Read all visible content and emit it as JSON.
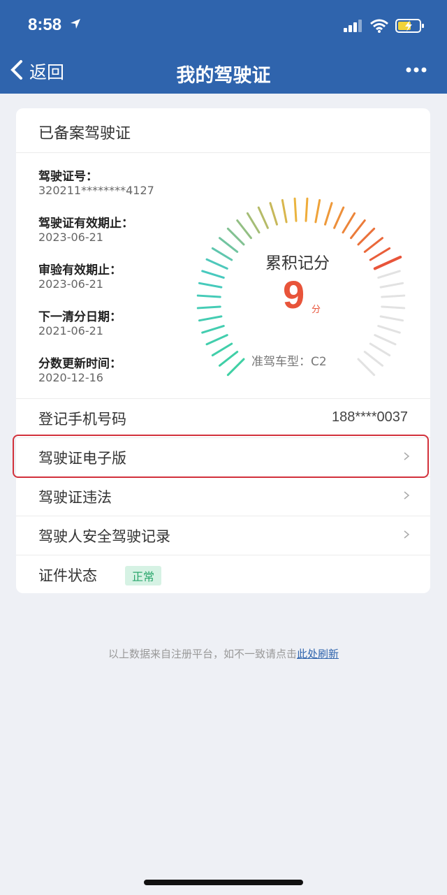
{
  "status_bar": {
    "time": "8:58"
  },
  "nav": {
    "back_label": "返回",
    "title": "我的驾驶证"
  },
  "card": {
    "title": "已备案驾驶证",
    "info": [
      {
        "label": "驾驶证号：",
        "value": "320211********4127"
      },
      {
        "label": "驾驶证有效期止：",
        "value": "2023-06-21"
      },
      {
        "label": "审验有效期止：",
        "value": "2023-06-21"
      },
      {
        "label": "下一清分日期：",
        "value": "2021-06-21"
      },
      {
        "label": "分数更新时间：",
        "value": "2020-12-16"
      }
    ],
    "gauge": {
      "title": "累积记分",
      "score": "9",
      "unit": "分",
      "max_score": 12,
      "vehicle_type": "准驾车型：C2",
      "active_colors": [
        "#3fd0a4",
        "#48c9c0",
        "#f0b33a",
        "#e8543a"
      ],
      "inactive_color": "#e2e2e2"
    },
    "rows": {
      "phone_label": "登记手机号码",
      "phone_value": "188****0037",
      "e_license_label": "驾驶证电子版",
      "violations_label": "驾驶证违法",
      "safety_record_label": "驾驶人安全驾驶记录",
      "status_label": "证件状态",
      "status_badge": "正常"
    }
  },
  "footer": {
    "note": "以上数据来自注册平台，如不一致请点击",
    "link": "此处刷新"
  },
  "colors": {
    "header": "#2f64ad",
    "accent_orange": "#e8543a",
    "highlight_border": "#d2313b"
  }
}
